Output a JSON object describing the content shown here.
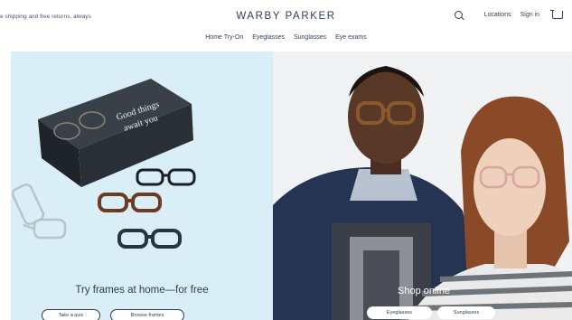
{
  "header": {
    "promo": "e shipping and free returns, always",
    "logo": "WARBY PARKER",
    "nav": [
      "Home Try-On",
      "Eyeglasses",
      "Sunglasses",
      "Eye exams"
    ],
    "locations": "Locations",
    "sign_in": "Sign in"
  },
  "left_panel": {
    "box_text_line1": "Good things",
    "box_text_line2": "await you",
    "tagline": "Try frames at home—for free",
    "btn_quiz": "Take a quiz",
    "btn_browse": "Browse frames"
  },
  "right_panel": {
    "shop_label": "Shop online",
    "btn_eyeglasses": "Eyeglasses",
    "btn_sunglasses": "Sunglasses"
  },
  "colors": {
    "left_bg": "#d9eef6",
    "brand_text": "#2e3f55",
    "box": "#2a2f36"
  }
}
